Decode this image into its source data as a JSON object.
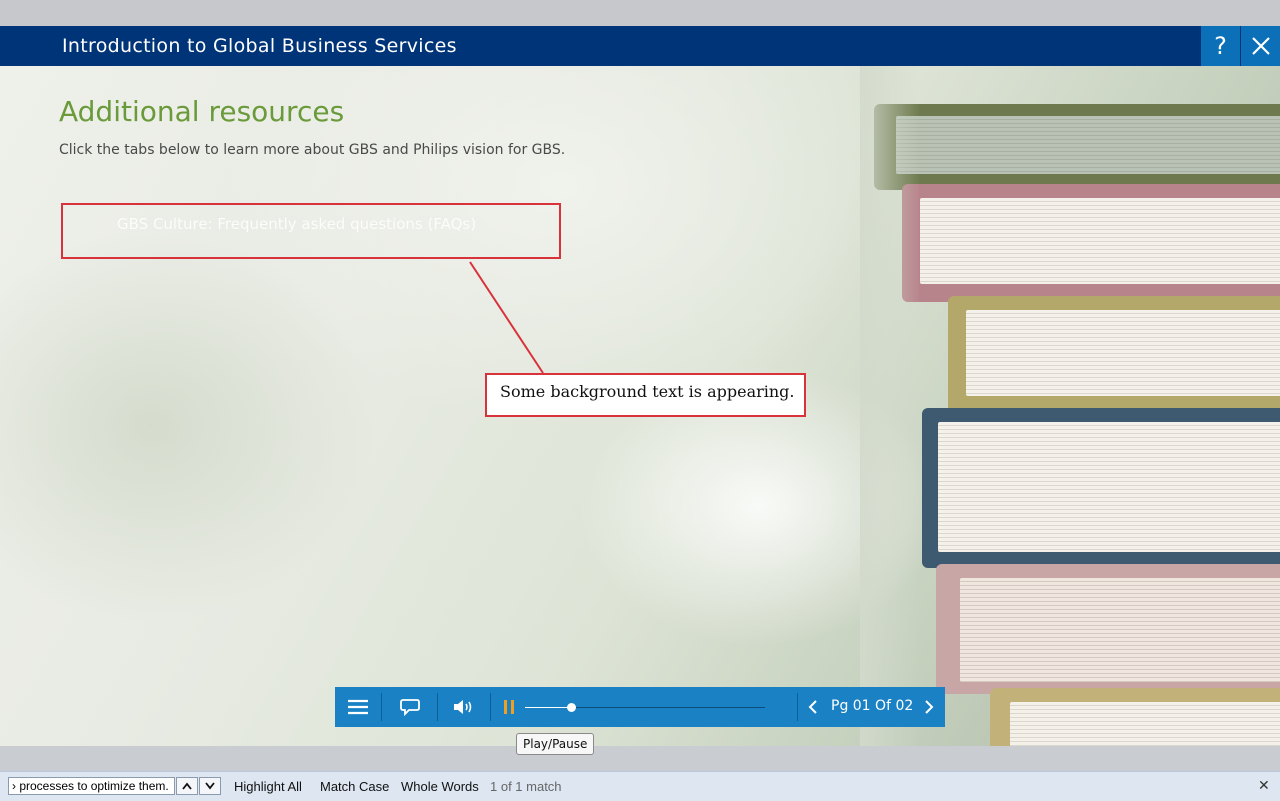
{
  "window": {
    "title": "Introduction to Global Business Services",
    "help_label": "?",
    "close_label": "✕"
  },
  "content": {
    "heading": "Additional resources",
    "intro": "Click the tabs below to learn more about GBS and Philips vision for GBS.",
    "tab_label": "GBS Culture: Frequently asked questions (FAQs)"
  },
  "annotation": {
    "text": "Some background text is appearing."
  },
  "player": {
    "progress": 0.19,
    "page_label": "Pg 01 Of 02",
    "tooltip": "Play/Pause",
    "icons": [
      "menu-icon",
      "transcript-icon",
      "volume-icon",
      "pause-icon",
      "prev-icon",
      "next-icon"
    ]
  },
  "findbar": {
    "query": "› processes to optimize them.",
    "highlight_all": "Highlight All",
    "match_case": "Match Case",
    "whole_words": "Whole Words",
    "status": "1 of 1 match",
    "close": "✕"
  },
  "colors": {
    "title_bar": "#003478",
    "accent_blue": "#0b70b8",
    "player_bg": "#1a82c4",
    "heading_green": "#6a9a3a",
    "annotation_red": "#d8323a",
    "pause_orange": "#f0a020"
  }
}
